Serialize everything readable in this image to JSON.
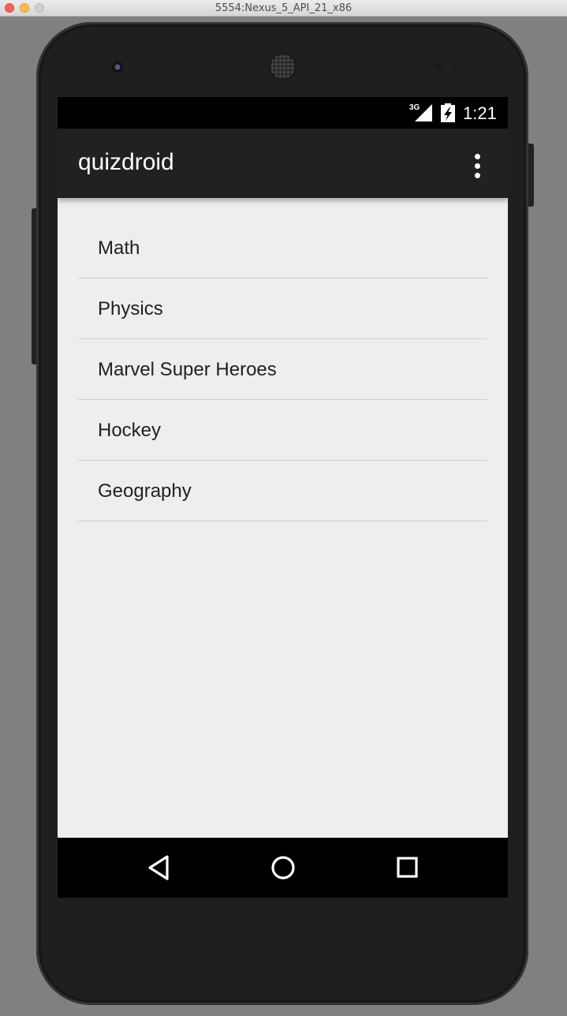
{
  "window": {
    "title": "5554:Nexus_5_API_21_x86"
  },
  "status_bar": {
    "network_type": "3G",
    "time": "1:21",
    "icons": [
      "signal-icon",
      "battery-charging-icon"
    ]
  },
  "app_bar": {
    "title": "quizdroid",
    "menu_icon": "overflow-menu-icon"
  },
  "topics": [
    {
      "label": "Math"
    },
    {
      "label": "Physics"
    },
    {
      "label": "Marvel Super Heroes"
    },
    {
      "label": "Hockey"
    },
    {
      "label": "Geography"
    }
  ],
  "navigation_bar": {
    "buttons": [
      "back-icon",
      "home-icon",
      "recents-icon"
    ]
  },
  "colors": {
    "app_bar": "#212121",
    "background": "#eeeeee",
    "status_bar": "#000000",
    "nav_bar": "#000000",
    "divider": "#cfcfcf",
    "text_primary": "#212121"
  }
}
